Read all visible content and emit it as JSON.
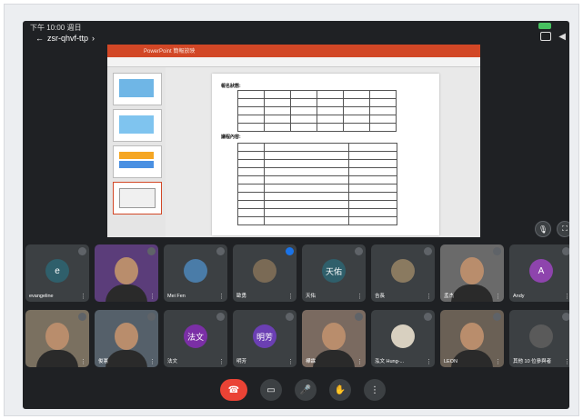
{
  "status_bar": {
    "time": "下午 10:00 週日"
  },
  "meeting": {
    "code": "zsr-qhvf-ttp",
    "chevron": "›",
    "presenter_title": "PowerPoint 簡報放映"
  },
  "slide": {
    "heading1": "報名狀態:",
    "heading2": "議程內容:"
  },
  "participants": [
    {
      "name": "evangeline",
      "initial": "e",
      "avatar_color": "#2f5f6b",
      "type": "initial"
    },
    {
      "name": "",
      "type": "photo"
    },
    {
      "name": "Mei Fen",
      "type": "photo"
    },
    {
      "name": "歐勇",
      "type": "photo",
      "speaking": true
    },
    {
      "name": "天佑",
      "initial": "天佑",
      "avatar_color": "#2f5f6b",
      "type": "initial"
    },
    {
      "name": "吉長",
      "type": "photo"
    },
    {
      "name": "孟杰",
      "type": "photo"
    },
    {
      "name": "Andy",
      "initial": "A",
      "avatar_color": "#8e44ad",
      "type": "initial"
    },
    {
      "name": "",
      "type": "photo"
    },
    {
      "name": "俊憲",
      "type": "photo"
    },
    {
      "name": "法文",
      "initial": "法文",
      "avatar_color": "#7b2fa6",
      "type": "initial"
    },
    {
      "name": "明芳",
      "initial": "明芳",
      "avatar_color": "#6b3fb3",
      "type": "initial"
    },
    {
      "name": "樺霖",
      "type": "photo"
    },
    {
      "name": "泓文 Hung-...",
      "type": "photo"
    },
    {
      "name": "LEON",
      "type": "photo"
    },
    {
      "name": "其他 10 位參與者",
      "type": "photo"
    }
  ],
  "controls": {
    "end_call_icon": "phone-hangup-icon",
    "camera_icon": "camera-icon",
    "mic_icon": "microphone-icon",
    "hand_icon": "raise-hand-icon",
    "more_icon": "more-vertical-icon"
  },
  "colors": {
    "end_call": "#ea4335",
    "tile_bg": "#3c4043",
    "app_bg": "#1f2124"
  }
}
